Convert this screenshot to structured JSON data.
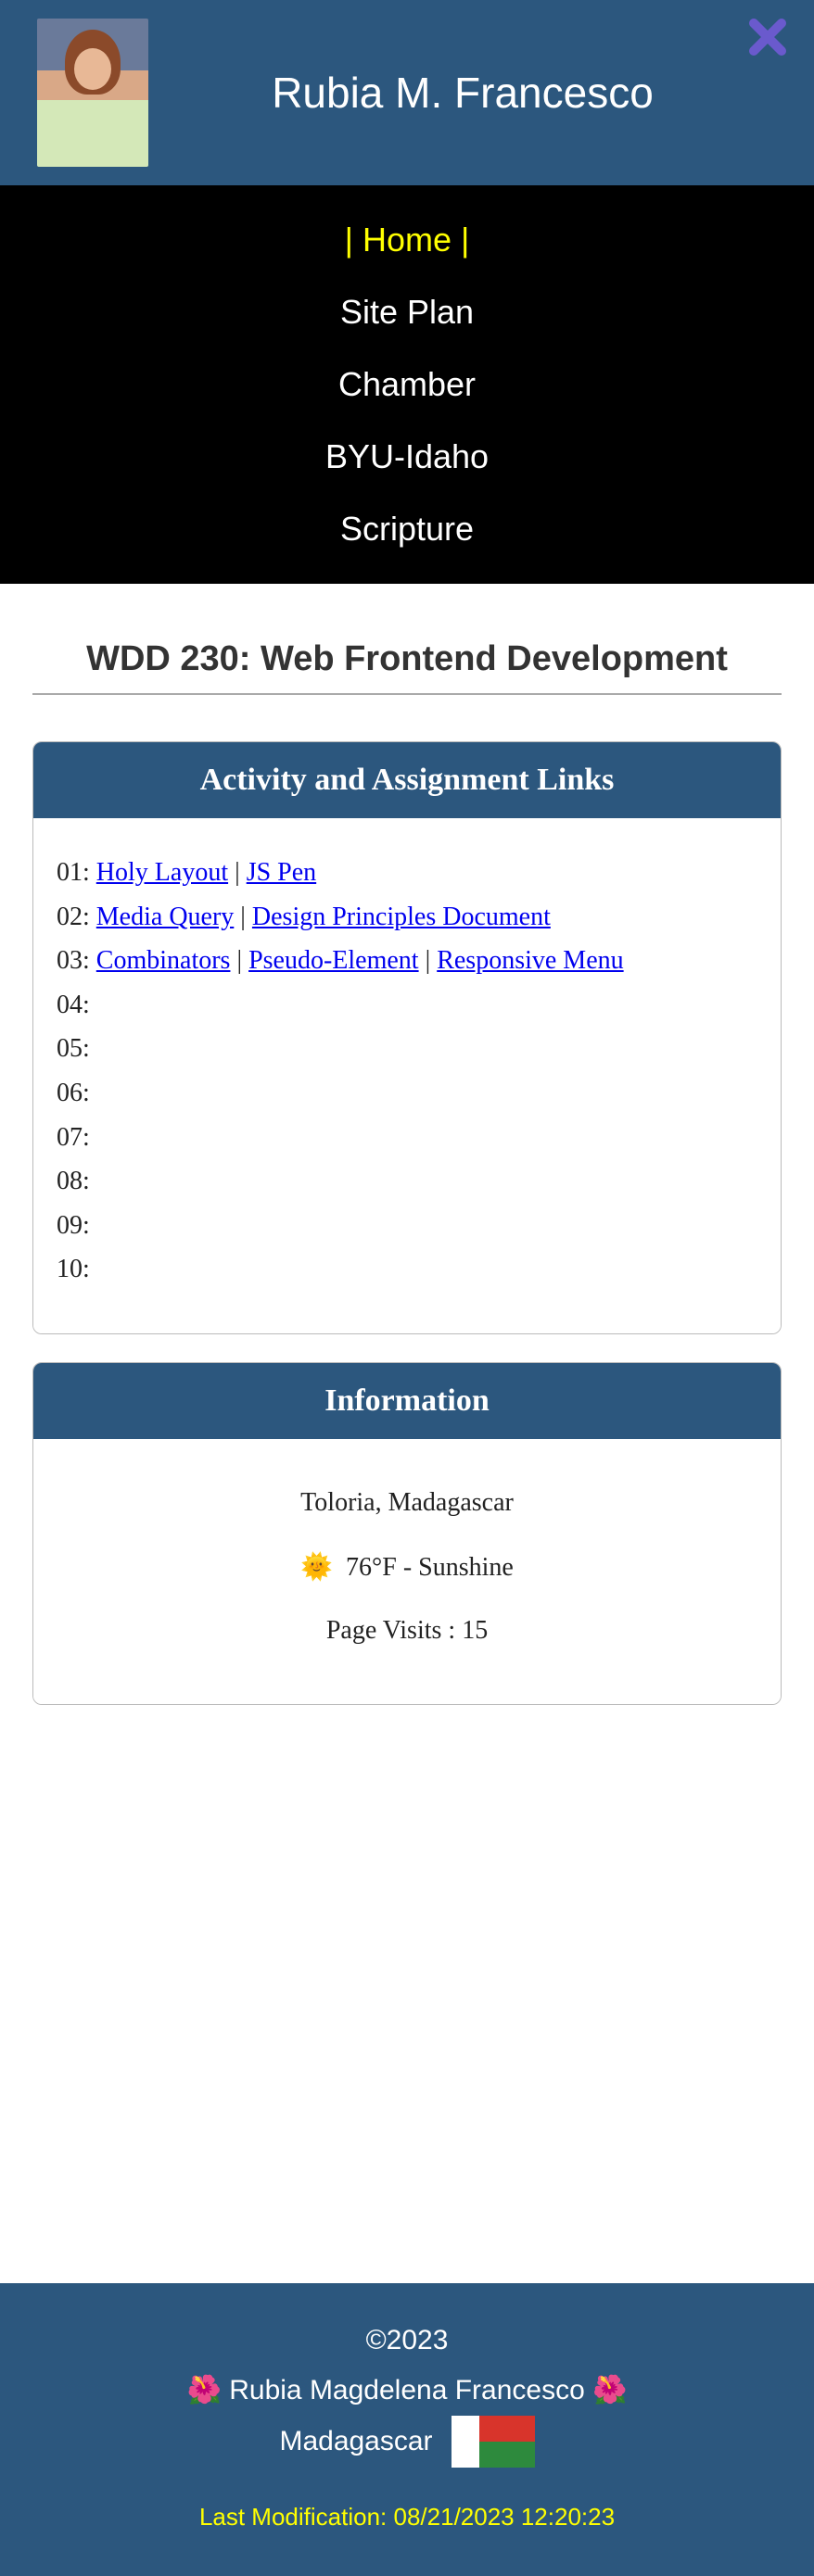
{
  "header": {
    "title": "Rubia M. Francesco"
  },
  "nav": {
    "items": [
      {
        "label": "| Home |",
        "active": true
      },
      {
        "label": "Site Plan",
        "active": false
      },
      {
        "label": "Chamber",
        "active": false
      },
      {
        "label": "BYU-Idaho",
        "active": false
      },
      {
        "label": "Scripture",
        "active": false
      }
    ]
  },
  "page": {
    "title": "WDD 230: Web Frontend Development"
  },
  "activities": {
    "heading": "Activity and Assignment Links",
    "rows": [
      {
        "prefix": "01: ",
        "links": [
          "Holy Layout",
          "JS Pen"
        ]
      },
      {
        "prefix": "02: ",
        "links": [
          "Media Query",
          "Design Principles Document"
        ]
      },
      {
        "prefix": "03: ",
        "links": [
          "Combinators",
          "Pseudo-Element",
          "Responsive Menu"
        ]
      },
      {
        "prefix": "04:",
        "links": []
      },
      {
        "prefix": "05:",
        "links": []
      },
      {
        "prefix": "06:",
        "links": []
      },
      {
        "prefix": "07:",
        "links": []
      },
      {
        "prefix": "08:",
        "links": []
      },
      {
        "prefix": "09:",
        "links": []
      },
      {
        "prefix": "10:",
        "links": []
      }
    ]
  },
  "info": {
    "heading": "Information",
    "location": "Toloria, Madagascar",
    "weather_emoji": "🌞",
    "weather": "76°F - Sunshine",
    "visits_label": "Page Visits : ",
    "visits": "15"
  },
  "footer": {
    "copyright": "©2023",
    "flower": "🌺",
    "name": "Rubia Magdelena Francesco",
    "country": "Madagascar",
    "last_mod_label": "Last Modification: ",
    "last_mod": "08/21/2023 12:20:23"
  }
}
